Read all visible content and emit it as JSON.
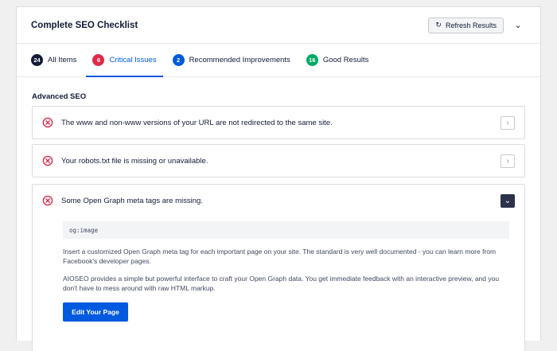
{
  "header": {
    "title": "Complete SEO Checklist",
    "refresh_label": "Refresh Results",
    "refresh_icon": "↻",
    "collapse_icon": "⌄"
  },
  "tabs": [
    {
      "count": "24",
      "label": "All Items",
      "color": "#141b38"
    },
    {
      "count": "6",
      "label": "Critical Issues",
      "color": "#df2a4a"
    },
    {
      "count": "2",
      "label": "Recommended Improvements",
      "color": "#005ae0"
    },
    {
      "count": "16",
      "label": "Good Results",
      "color": "#00aa63"
    }
  ],
  "section": {
    "title": "Advanced SEO"
  },
  "items": [
    {
      "text": "The www and non-www versions of your URL are not redirected to the same site.",
      "icon": "›"
    },
    {
      "text": "Your robots.txt file is missing or unavailable.",
      "icon": "›"
    },
    {
      "text": "Some Open Graph meta tags are missing.",
      "icon": "⌄",
      "code": "og:image",
      "para1": "Insert a customized Open Graph meta tag for each important page on your site. The standard is very well documented - you can learn more from Facebook's developer pages.",
      "para2": "AIOSEO provides a simple but powerful interface to craft your Open Graph data. You get immediate feedback with an interactive preview, and you don't have to mess around with raw HTML markup.",
      "button": "Edit Your Page"
    }
  ],
  "colors": {
    "accent": "#005ae0",
    "critical": "#df2a4a",
    "good": "#00aa63"
  }
}
